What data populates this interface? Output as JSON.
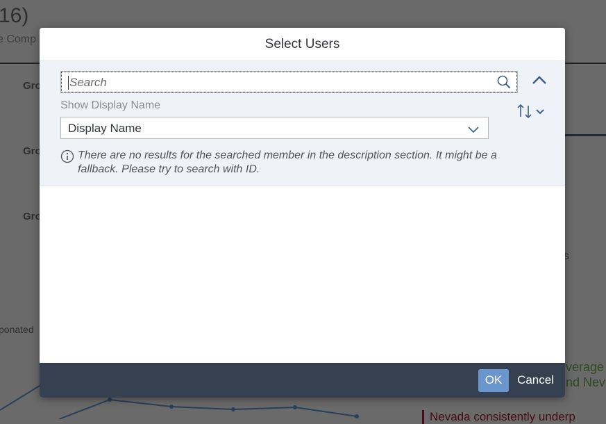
{
  "background": {
    "title_fragment": "16)",
    "subtitle_fragment": "e Comp",
    "row_labels": [
      "Gro",
      "Gro",
      "Gro"
    ],
    "left_label": "ponated",
    "right_text_1": "verage",
    "right_text_2": "nd Nev",
    "bottom_text": "Nevada consistently underp",
    "right_fragment": "s"
  },
  "dialog": {
    "title": "Select Users",
    "search": {
      "placeholder": "Search",
      "icon": "search-icon"
    },
    "display_label": "Show Display Name",
    "display_select": "Display Name",
    "info_message": "There are no results for the searched member in the description section. It might be a fallback. Please try to search with ID.",
    "ok_label": "OK",
    "cancel_label": "Cancel"
  }
}
